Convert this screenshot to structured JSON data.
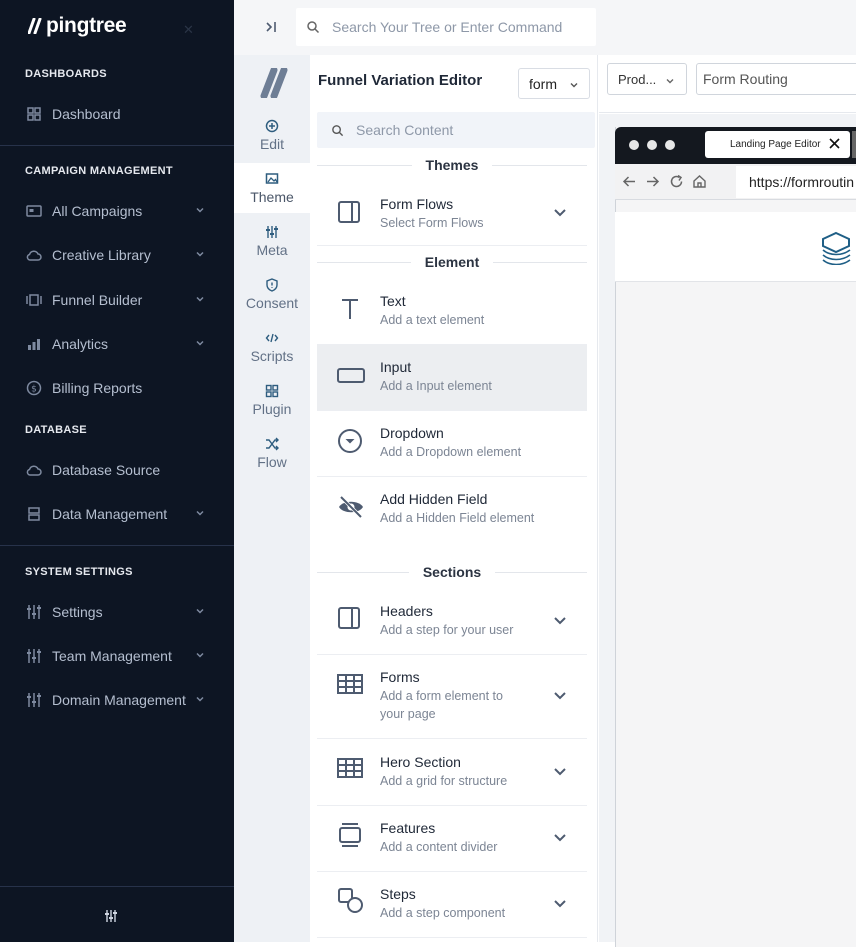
{
  "app": {
    "brand": "pingtree"
  },
  "sidebar": {
    "sections": {
      "dashboards": "DASHBOARDS",
      "campaign": "CAMPAIGN MANAGEMENT",
      "database": "DATABASE",
      "system": "SYSTEM SETTINGS"
    },
    "items": [
      {
        "label": "Dashboard",
        "icon": "dashboard-icon"
      },
      {
        "label": "All Campaigns",
        "icon": "campaigns-icon"
      },
      {
        "label": "Creative Library",
        "icon": "cloud-icon"
      },
      {
        "label": "Funnel Builder",
        "icon": "funnel-icon"
      },
      {
        "label": "Analytics",
        "icon": "bar-chart-icon"
      },
      {
        "label": "Billing Reports",
        "icon": "dollar-icon"
      },
      {
        "label": "Database Source",
        "icon": "cloud-icon"
      },
      {
        "label": "Data Management",
        "icon": "database-icon"
      },
      {
        "label": "Settings",
        "icon": "sliders-icon"
      },
      {
        "label": "Team Management",
        "icon": "sliders-icon"
      },
      {
        "label": "Domain Management",
        "icon": "sliders-icon"
      }
    ]
  },
  "topbar": {
    "search_placeholder": "Search Your Tree or Enter Command"
  },
  "rail": [
    {
      "label": "Edit"
    },
    {
      "label": "Theme"
    },
    {
      "label": "Meta"
    },
    {
      "label": "Consent"
    },
    {
      "label": "Scripts"
    },
    {
      "label": "Plugin"
    },
    {
      "label": "Flow"
    }
  ],
  "panel": {
    "title": "Funnel Variation Editor",
    "select_value": "form",
    "search_placeholder": "Search Content",
    "themes_header": "Themes",
    "element_header": "Element",
    "sections_header": "Sections",
    "themes": [
      {
        "title": "Form Flows",
        "subtitle": "Select Form Flows"
      }
    ],
    "elements": [
      {
        "title": "Text",
        "subtitle": "Add a text element"
      },
      {
        "title": "Input",
        "subtitle": "Add a Input element"
      },
      {
        "title": "Dropdown",
        "subtitle": "Add a Dropdown element"
      },
      {
        "title": "Add Hidden Field",
        "subtitle": "Add a Hidden Field element"
      }
    ],
    "sections": [
      {
        "title": "Headers",
        "subtitle": "Add a step for your user"
      },
      {
        "title": "Forms",
        "subtitle": "Add a form element to your page"
      },
      {
        "title": "Hero Section",
        "subtitle": "Add a grid for structure"
      },
      {
        "title": "Features",
        "subtitle": "Add a content divider"
      },
      {
        "title": "Steps",
        "subtitle": "Add a step component"
      }
    ]
  },
  "preview": {
    "env_button": "Prod...",
    "routing_value": "Form Routing",
    "tab_title": "Landing Page Editor",
    "url": "https://formroutin"
  }
}
